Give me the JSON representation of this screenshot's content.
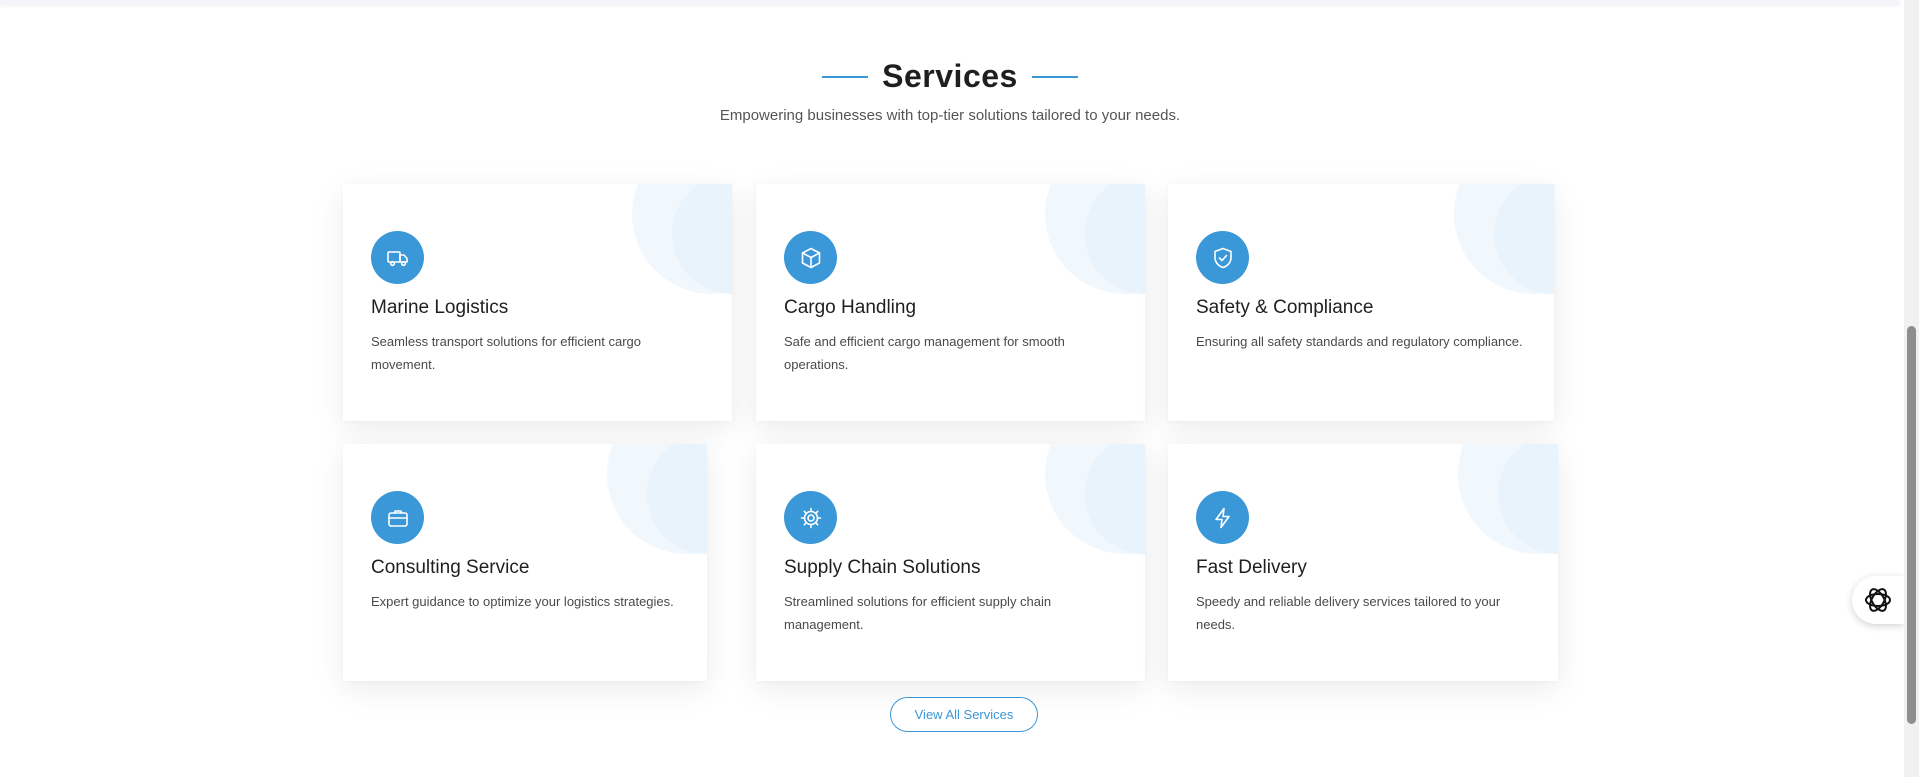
{
  "section": {
    "title": "Services",
    "subtitle": "Empowering businesses with top-tier solutions tailored to your needs."
  },
  "services": [
    {
      "icon": "truck-icon",
      "title": "Marine Logistics",
      "description": "Seamless transport solutions for efficient cargo movement."
    },
    {
      "icon": "box-icon",
      "title": "Cargo Handling",
      "description": "Safe and efficient cargo management for smooth operations."
    },
    {
      "icon": "shield-check-icon",
      "title": "Safety & Compliance",
      "description": "Ensuring all safety standards and regulatory compliance."
    },
    {
      "icon": "briefcase-icon",
      "title": "Consulting Service",
      "description": "Expert guidance to optimize your logistics strategies."
    },
    {
      "icon": "gear-icon",
      "title": "Supply Chain Solutions",
      "description": "Streamlined solutions for efficient supply chain management."
    },
    {
      "icon": "lightning-icon",
      "title": "Fast Delivery",
      "description": "Speedy and reliable delivery services tailored to your needs."
    }
  ],
  "cta": {
    "label": "View All Services"
  },
  "widgets": {
    "chat_icon": "openai-logo-icon"
  },
  "colors": {
    "accent": "#3a97d8",
    "heading": "#1f1f1f",
    "text": "#4a4a4a"
  }
}
